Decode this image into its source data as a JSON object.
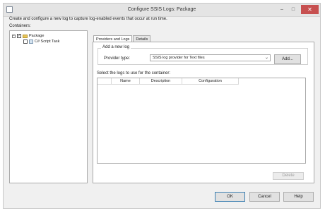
{
  "window": {
    "title": "Configure SSIS Logs: Package",
    "minimize_glyph": "–",
    "maximize_glyph": "□",
    "close_glyph": "✕"
  },
  "intro_text": "Create and configure a new log to capture log-enabled events that occur at run time.",
  "containers_label": "Containers:",
  "tree": {
    "items": [
      {
        "label": "Package",
        "checked": true,
        "expanded": true,
        "icon": "folder-icon"
      },
      {
        "label": "C# Script Task",
        "checked": false,
        "icon": "script-task-icon"
      }
    ],
    "expander_glyph": "−",
    "check_glyph": "✓"
  },
  "tabs": [
    {
      "label": "Providers and Logs",
      "active": true
    },
    {
      "label": "Details",
      "active": false
    }
  ],
  "add_log_group": {
    "legend": "Add a new log",
    "provider_label": "Provider type:",
    "provider_value": "SSIS log provider for Text files",
    "chevron_glyph": "⌄",
    "add_button": "Add..."
  },
  "select_logs_label": "Select the logs to use for the container:",
  "log_table": {
    "columns": [
      "",
      "Name",
      "Description",
      "Configuration"
    ],
    "rows": []
  },
  "buttons": {
    "delete": "Delete",
    "ok": "OK",
    "cancel": "Cancel",
    "help": "Help"
  }
}
